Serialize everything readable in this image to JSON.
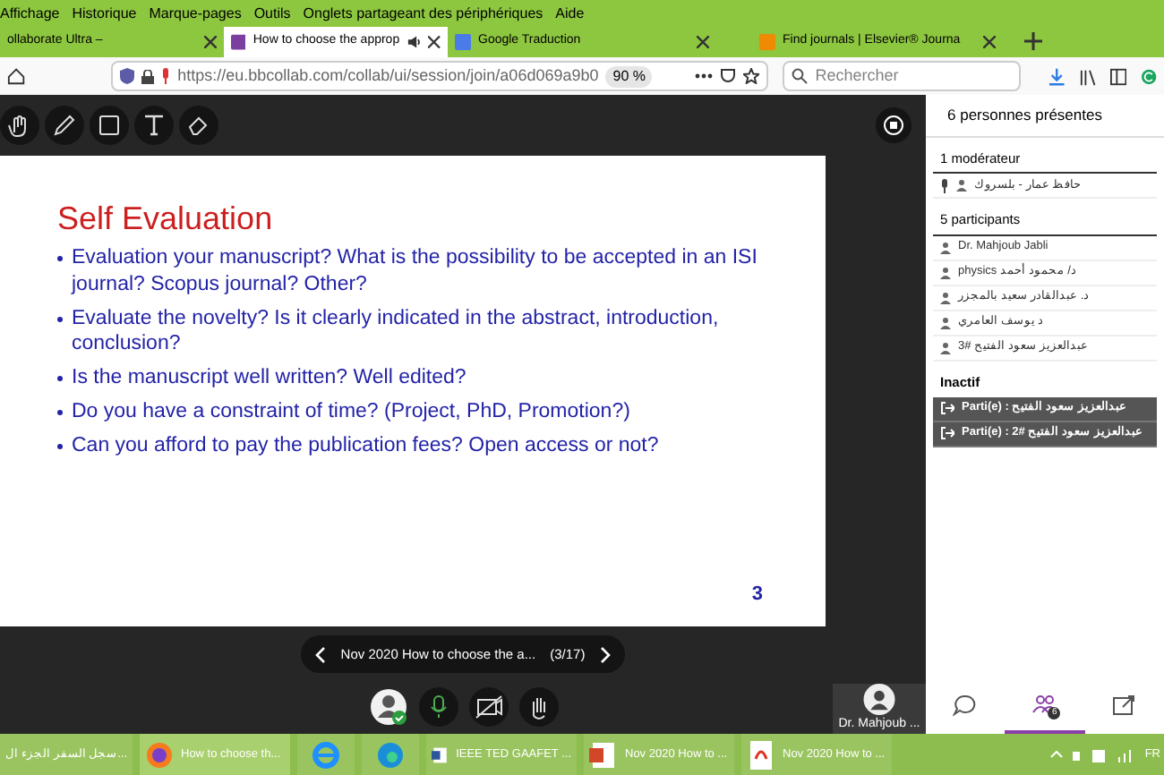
{
  "menu_bar": [
    "Affichage",
    "Historique",
    "Marque-pages",
    "Outils",
    "Onglets partageant des périphériques",
    "Aide"
  ],
  "tabs": [
    {
      "label": "ollaborate Ultra –",
      "selected": false,
      "audio": false
    },
    {
      "label": "How to choose the approp",
      "selected": true,
      "audio": true
    },
    {
      "label": "Google Traduction",
      "selected": false,
      "audio": false
    },
    {
      "label": "Find journals | Elsevier® Journa",
      "selected": false,
      "audio": false
    }
  ],
  "address_bar": {
    "url": "https://eu.bbcollab.com/collab/ui/session/join/a06d069a9b0",
    "zoom": "90 %"
  },
  "search": {
    "placeholder": "Rechercher"
  },
  "slide": {
    "title": "Self Evaluation",
    "bullets": [
      "Evaluation your manuscript? What is the possibility to be accepted in an ISI journal? Scopus journal? Other?",
      "Evaluate the novelty? Is it clearly indicated in the abstract, introduction, conclusion?",
      "Is the manuscript well written? Well edited?",
      "Do you have a constraint of time? (Project, PhD, Promotion?)",
      "Can you afford to pay the publication fees? Open access or not?"
    ],
    "page_number": "3"
  },
  "slide_nav": {
    "title": "Nov 2020 How to choose the a...",
    "counter": "(3/17)"
  },
  "presenter": {
    "name": "Dr. Mahjoub ..."
  },
  "panel": {
    "heading": "6 personnes présentes",
    "groups": [
      {
        "title": "1 modérateur",
        "kind": "active",
        "members": [
          {
            "name": "حافظ عمار - بلسروك",
            "mic": true
          }
        ]
      },
      {
        "title": "5 participants",
        "kind": "active",
        "members": [
          {
            "name": "Dr. Mahjoub Jabli",
            "mic": false
          },
          {
            "name": "physics د/ محمود أحمد",
            "mic": false
          },
          {
            "name": "د. عبدالقادر سعيد بالمجزر",
            "mic": false
          },
          {
            "name": "د يوسف العامري",
            "mic": false
          },
          {
            "name": "3# عبدالعزيز سعود الفتيح",
            "mic": false
          }
        ]
      },
      {
        "title": "Inactif",
        "kind": "left",
        "members": [
          {
            "name": "Parti(e) : عبدالعزيز سعود الفتيح",
            "mic": false
          },
          {
            "name": "Parti(e) : 2# عبدالعزيز سعود الفتيح",
            "mic": false
          }
        ]
      }
    ]
  },
  "panel_tabs": [
    {
      "kind": "chat",
      "selected": false
    },
    {
      "kind": "people",
      "selected": true,
      "badge": "6"
    },
    {
      "kind": "share",
      "selected": false
    }
  ],
  "taskbar": [
    {
      "kind": "blank",
      "label": "سجل السفر الجزء ال...",
      "selected": false
    },
    {
      "kind": "firefox",
      "label": "How to choose th...",
      "selected": true
    },
    {
      "kind": "ie",
      "selected": false
    },
    {
      "kind": "edge",
      "selected": false
    },
    {
      "kind": "word",
      "label": "IEEE TED GAAFET ...",
      "selected": false
    },
    {
      "kind": "ppt",
      "label": "Nov 2020 How to ...",
      "selected": false
    },
    {
      "kind": "pdf",
      "label": "Nov 2020 How to ...",
      "selected": false
    }
  ],
  "tray": {
    "language": "FR"
  }
}
